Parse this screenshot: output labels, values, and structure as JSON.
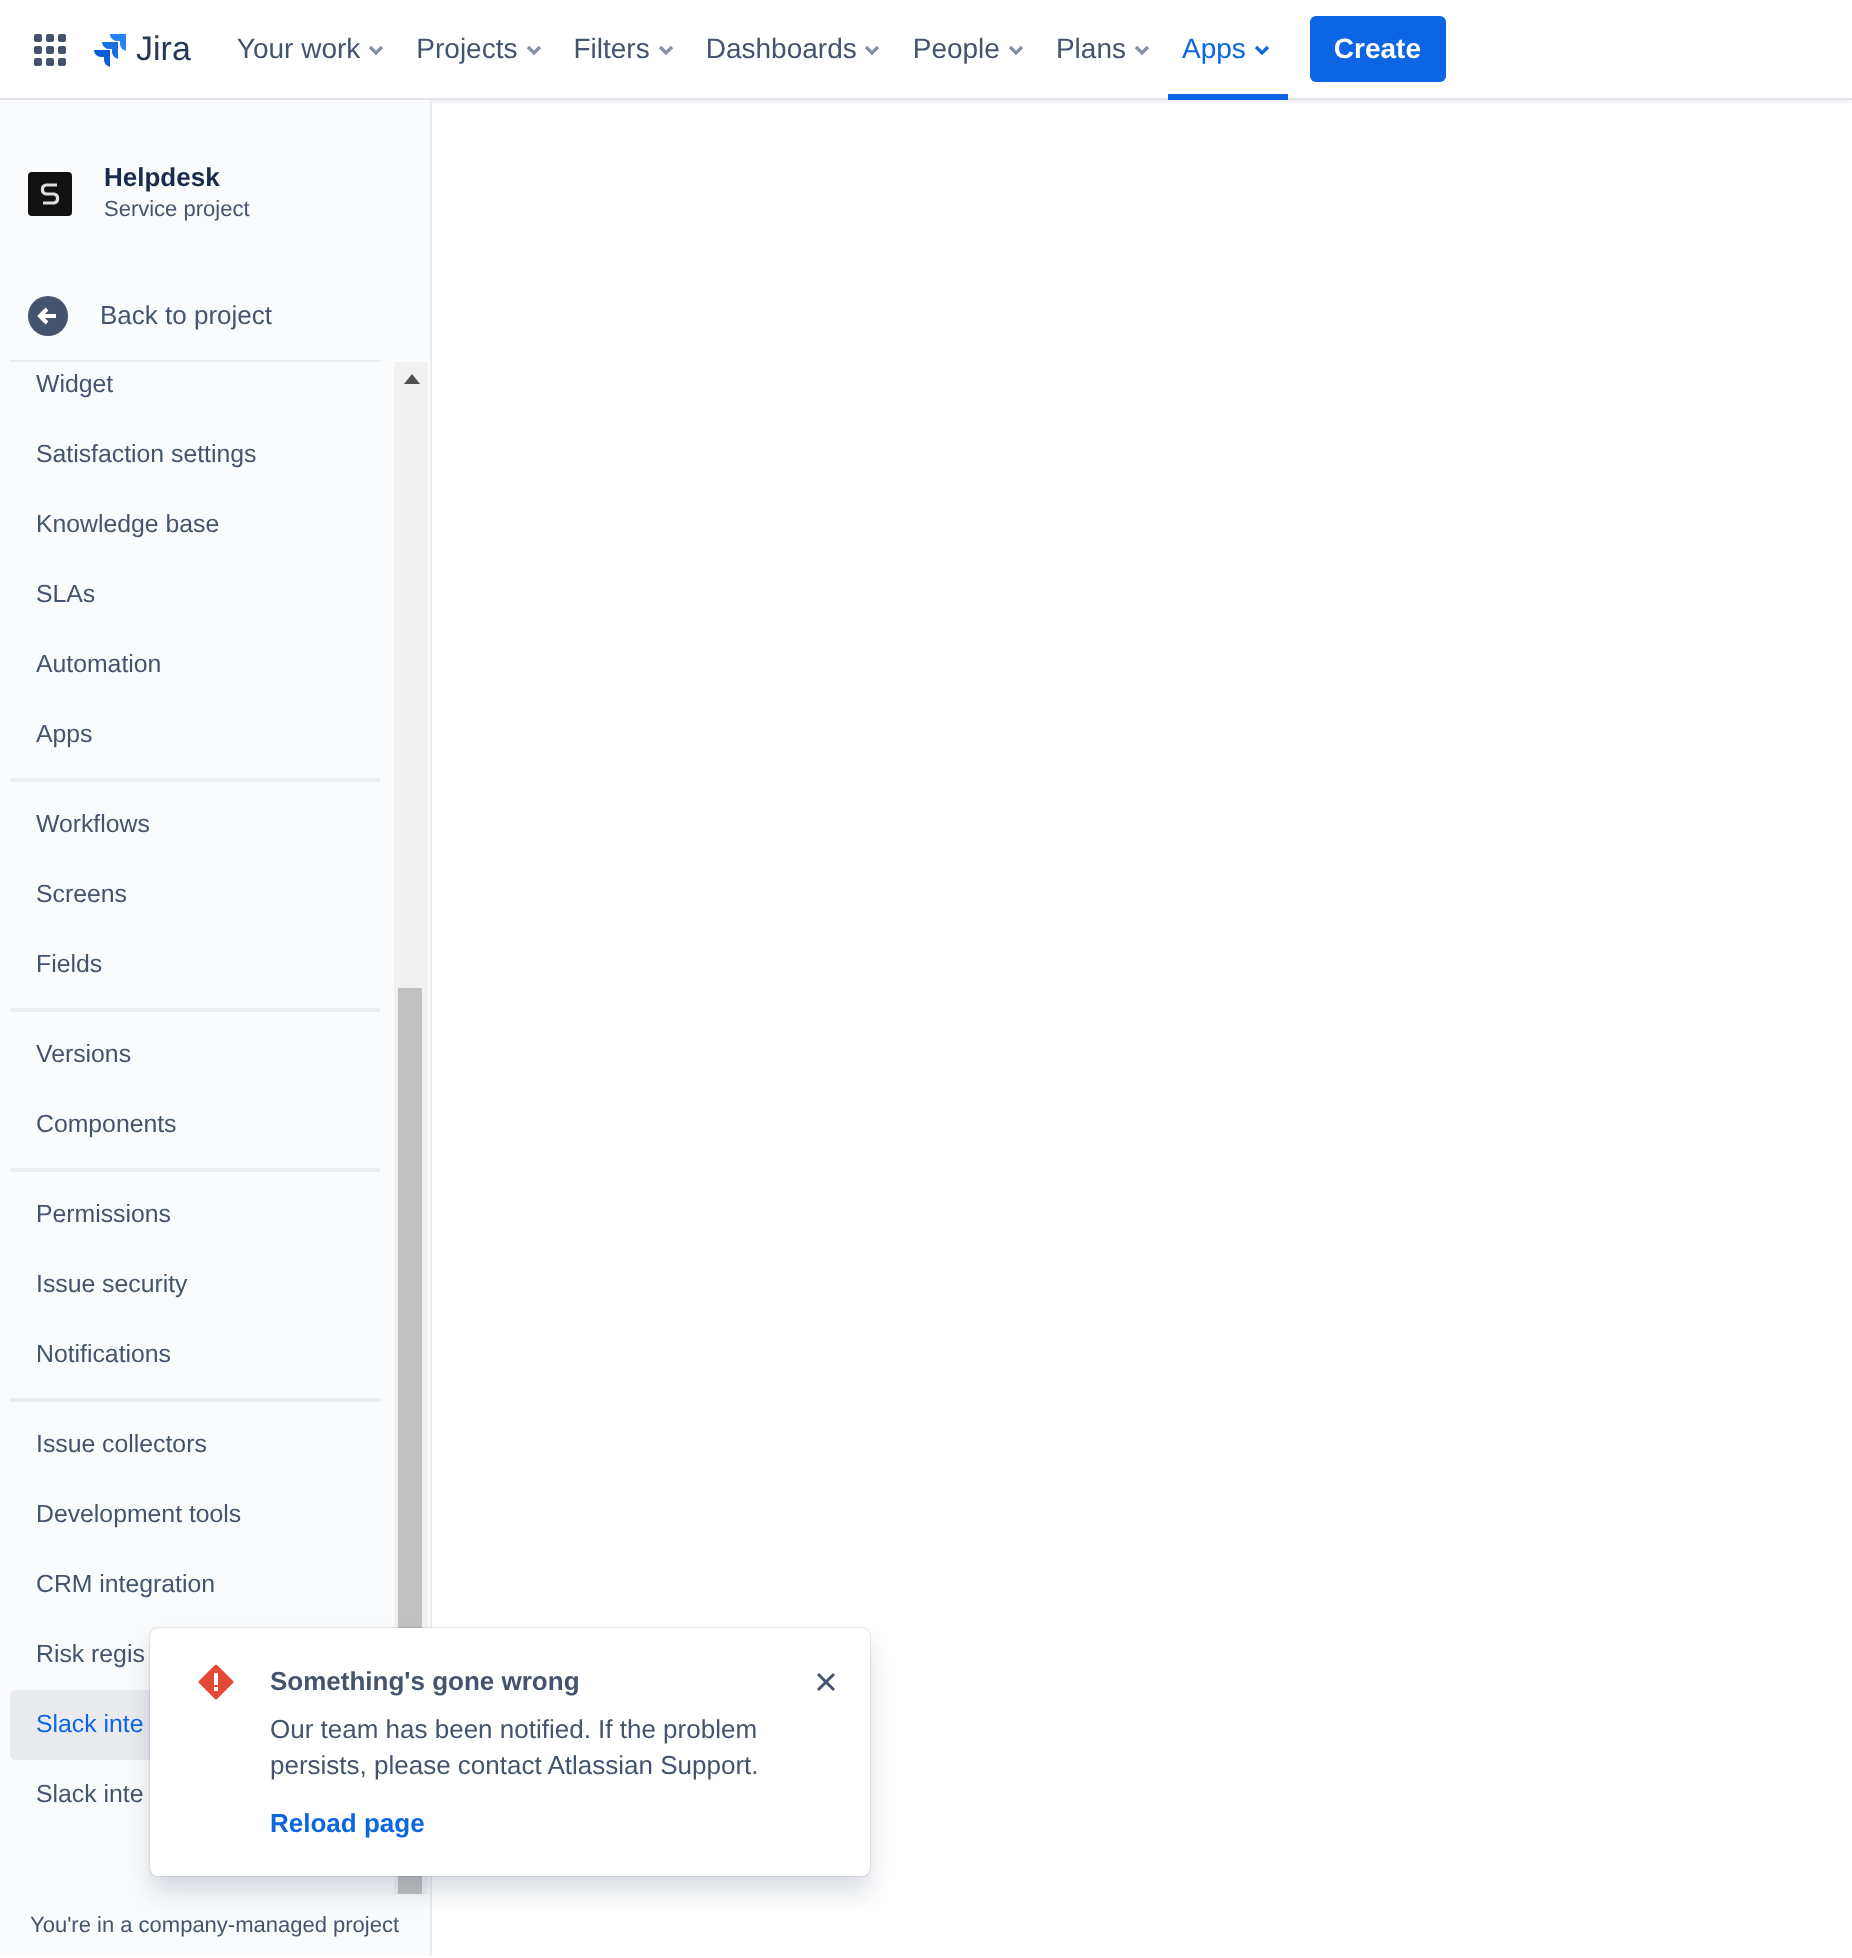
{
  "topnav": {
    "product": "Jira",
    "items": [
      {
        "label": "Your work",
        "selected": false
      },
      {
        "label": "Projects",
        "selected": false
      },
      {
        "label": "Filters",
        "selected": false
      },
      {
        "label": "Dashboards",
        "selected": false
      },
      {
        "label": "People",
        "selected": false
      },
      {
        "label": "Plans",
        "selected": false
      },
      {
        "label": "Apps",
        "selected": true
      }
    ],
    "create": "Create"
  },
  "sidebar": {
    "project": {
      "name": "Helpdesk",
      "type": "Service project"
    },
    "back": "Back to project",
    "groups": [
      [
        {
          "label": "Widget",
          "selected": false
        },
        {
          "label": "Satisfaction settings",
          "selected": false
        },
        {
          "label": "Knowledge base",
          "selected": false
        },
        {
          "label": "SLAs",
          "selected": false
        },
        {
          "label": "Automation",
          "selected": false
        },
        {
          "label": "Apps",
          "selected": false
        }
      ],
      [
        {
          "label": "Workflows",
          "selected": false
        },
        {
          "label": "Screens",
          "selected": false
        },
        {
          "label": "Fields",
          "selected": false
        }
      ],
      [
        {
          "label": "Versions",
          "selected": false
        },
        {
          "label": "Components",
          "selected": false
        }
      ],
      [
        {
          "label": "Permissions",
          "selected": false
        },
        {
          "label": "Issue security",
          "selected": false
        },
        {
          "label": "Notifications",
          "selected": false
        }
      ],
      [
        {
          "label": "Issue collectors",
          "selected": false
        },
        {
          "label": "Development tools",
          "selected": false
        },
        {
          "label": "CRM integration",
          "selected": false
        },
        {
          "label": "Risk regis",
          "selected": false
        },
        {
          "label": "Slack inte",
          "selected": true
        },
        {
          "label": "Slack inte",
          "selected": false
        }
      ]
    ],
    "footer": "You're in a company-managed project"
  },
  "flag": {
    "title": "Something's gone wrong",
    "message": "Our team has been notified. If the problem persists, please contact Atlassian Support.",
    "action": "Reload page"
  }
}
